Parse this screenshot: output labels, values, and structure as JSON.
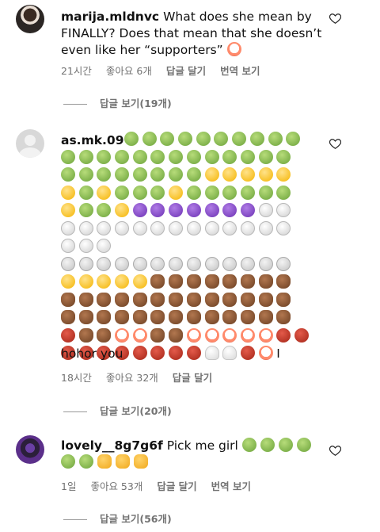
{
  "comments": [
    {
      "username": "marija.mldnvc",
      "text": "What does she mean by FINALLY? Does that mean that she doesn’t even like her “supporters”",
      "trailing_emoji": "clown-emoji",
      "time": "21시간",
      "likes": "좋아요 6개",
      "reply": "답글 달기",
      "translate": "번역 보기",
      "view_replies": "답글 보기(19개)"
    },
    {
      "username": "as.mk.09",
      "tail_text": "I",
      "tail_text2": "hohor you",
      "time": "18시간",
      "likes": "좋아요 32개",
      "reply": "답글 달기",
      "view_replies": "답글 보기(20개)",
      "emoji_rows": [
        [
          "green",
          "green",
          "green",
          "green",
          "green",
          "green",
          "green",
          "green",
          "green",
          "green"
        ],
        [
          "green",
          "green",
          "green",
          "green",
          "green",
          "green",
          "green",
          "green",
          "green",
          "green",
          "green",
          "green",
          "green"
        ],
        [
          "green",
          "green",
          "green",
          "green",
          "green",
          "green",
          "green",
          "green",
          "yellow",
          "yellow",
          "yellow",
          "yellow",
          "yellow"
        ],
        [
          "yellow",
          "green",
          "yellow",
          "green",
          "green",
          "green",
          "yellow",
          "green",
          "green",
          "green",
          "green",
          "green",
          "green"
        ],
        [
          "yellow",
          "green",
          "green",
          "yellow",
          "purple",
          "purple",
          "purple",
          "purple",
          "purple",
          "purple",
          "purple",
          "skull",
          "skull"
        ],
        [
          "skull",
          "skull",
          "skull",
          "skull",
          "skull",
          "skull",
          "skull",
          "skull",
          "skull",
          "skull",
          "skull",
          "skull",
          "skull"
        ],
        [
          "skull",
          "skull",
          "skull"
        ],
        [
          "cross",
          "cross",
          "cross",
          "cross",
          "cross",
          "cross",
          "cross",
          "cross",
          "cross",
          "cross",
          "cross",
          "cross",
          "cross"
        ],
        [
          "yellow",
          "yellow",
          "yellow",
          "yellow",
          "yellow",
          "poop",
          "poop",
          "poop",
          "poop",
          "poop",
          "poop",
          "poop",
          "poop"
        ],
        [
          "poop",
          "poop",
          "poop",
          "poop",
          "poop",
          "poop",
          "poop",
          "poop",
          "poop",
          "poop",
          "poop",
          "poop",
          "poop"
        ],
        [
          "poop",
          "poop",
          "poop",
          "poop",
          "poop",
          "poop",
          "poop",
          "poop",
          "poop",
          "poop",
          "poop",
          "poop",
          "poop"
        ],
        [
          "red",
          "poop",
          "poop",
          "clown",
          "clown",
          "poop",
          "poop",
          "clown",
          "clown",
          "clown",
          "clown",
          "clown",
          "red",
          "red"
        ],
        [
          "red",
          "red",
          "red",
          "red",
          "red",
          "red",
          "red",
          "red",
          "ghost",
          "ghost",
          "red",
          "clown",
          "text"
        ]
      ]
    },
    {
      "username": "lovely__8g7g6f",
      "text": "Pick me girl",
      "trailing_emojis": [
        "green",
        "green",
        "green",
        "green"
      ],
      "second_line_emojis": [
        "green",
        "green",
        "thumb",
        "thumb",
        "thumb"
      ],
      "time": "1일",
      "likes": "좋아요 53개",
      "reply": "답글 달기",
      "translate": "번역 보기",
      "view_replies": "답글 보기(56개)"
    }
  ]
}
